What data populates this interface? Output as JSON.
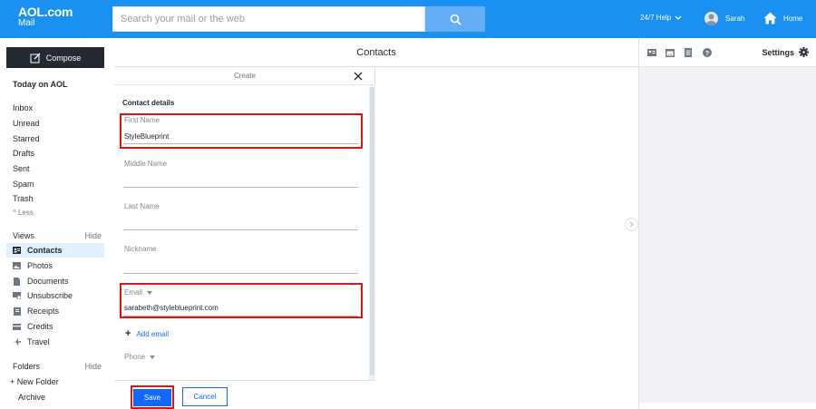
{
  "header": {
    "logo_line1": "AOL.com",
    "logo_line2": "Mail",
    "search_placeholder": "Search your mail or the web",
    "help_label": "24/7 Help",
    "user_name": "Sarah",
    "home_label": "Home",
    "accent_color": "#1a90f0"
  },
  "sidebar": {
    "compose_label": "Compose",
    "today_label": "Today on AOL",
    "folders": [
      {
        "label": "Inbox"
      },
      {
        "label": "Unread"
      },
      {
        "label": "Starred"
      },
      {
        "label": "Drafts"
      },
      {
        "label": "Sent"
      },
      {
        "label": "Spam"
      },
      {
        "label": "Trash"
      }
    ],
    "less_label": "^ Less",
    "views_label": "Views",
    "views_hide": "Hide",
    "views": [
      {
        "label": "Contacts",
        "icon": "contacts-icon",
        "active": true
      },
      {
        "label": "Photos",
        "icon": "photos-icon"
      },
      {
        "label": "Documents",
        "icon": "documents-icon"
      },
      {
        "label": "Unsubscribe",
        "icon": "unsubscribe-icon"
      },
      {
        "label": "Receipts",
        "icon": "receipts-icon"
      },
      {
        "label": "Credits",
        "icon": "credits-icon"
      },
      {
        "label": "Travel",
        "icon": "travel-icon"
      }
    ],
    "folders_label": "Folders",
    "folders_hide": "Hide",
    "new_folder_label": "+ New Folder",
    "archive_label": "Archive"
  },
  "contacts": {
    "title": "Contacts"
  },
  "create_panel": {
    "title": "Create",
    "section_title": "Contact details",
    "first_name": {
      "label": "First Name",
      "value": "StyleBlueprint"
    },
    "middle_name": {
      "label": "Middle Name",
      "value": ""
    },
    "last_name": {
      "label": "Last Name",
      "value": ""
    },
    "nickname": {
      "label": "Nickname",
      "value": ""
    },
    "email": {
      "label": "Email",
      "value": "sarabeth@styleblueprint.com"
    },
    "add_email_label": "Add email",
    "phone": {
      "label": "Phone"
    },
    "save_label": "Save",
    "cancel_label": "Cancel",
    "highlight_color": "#e8100c"
  },
  "right_panel": {
    "settings_label": "Settings"
  }
}
